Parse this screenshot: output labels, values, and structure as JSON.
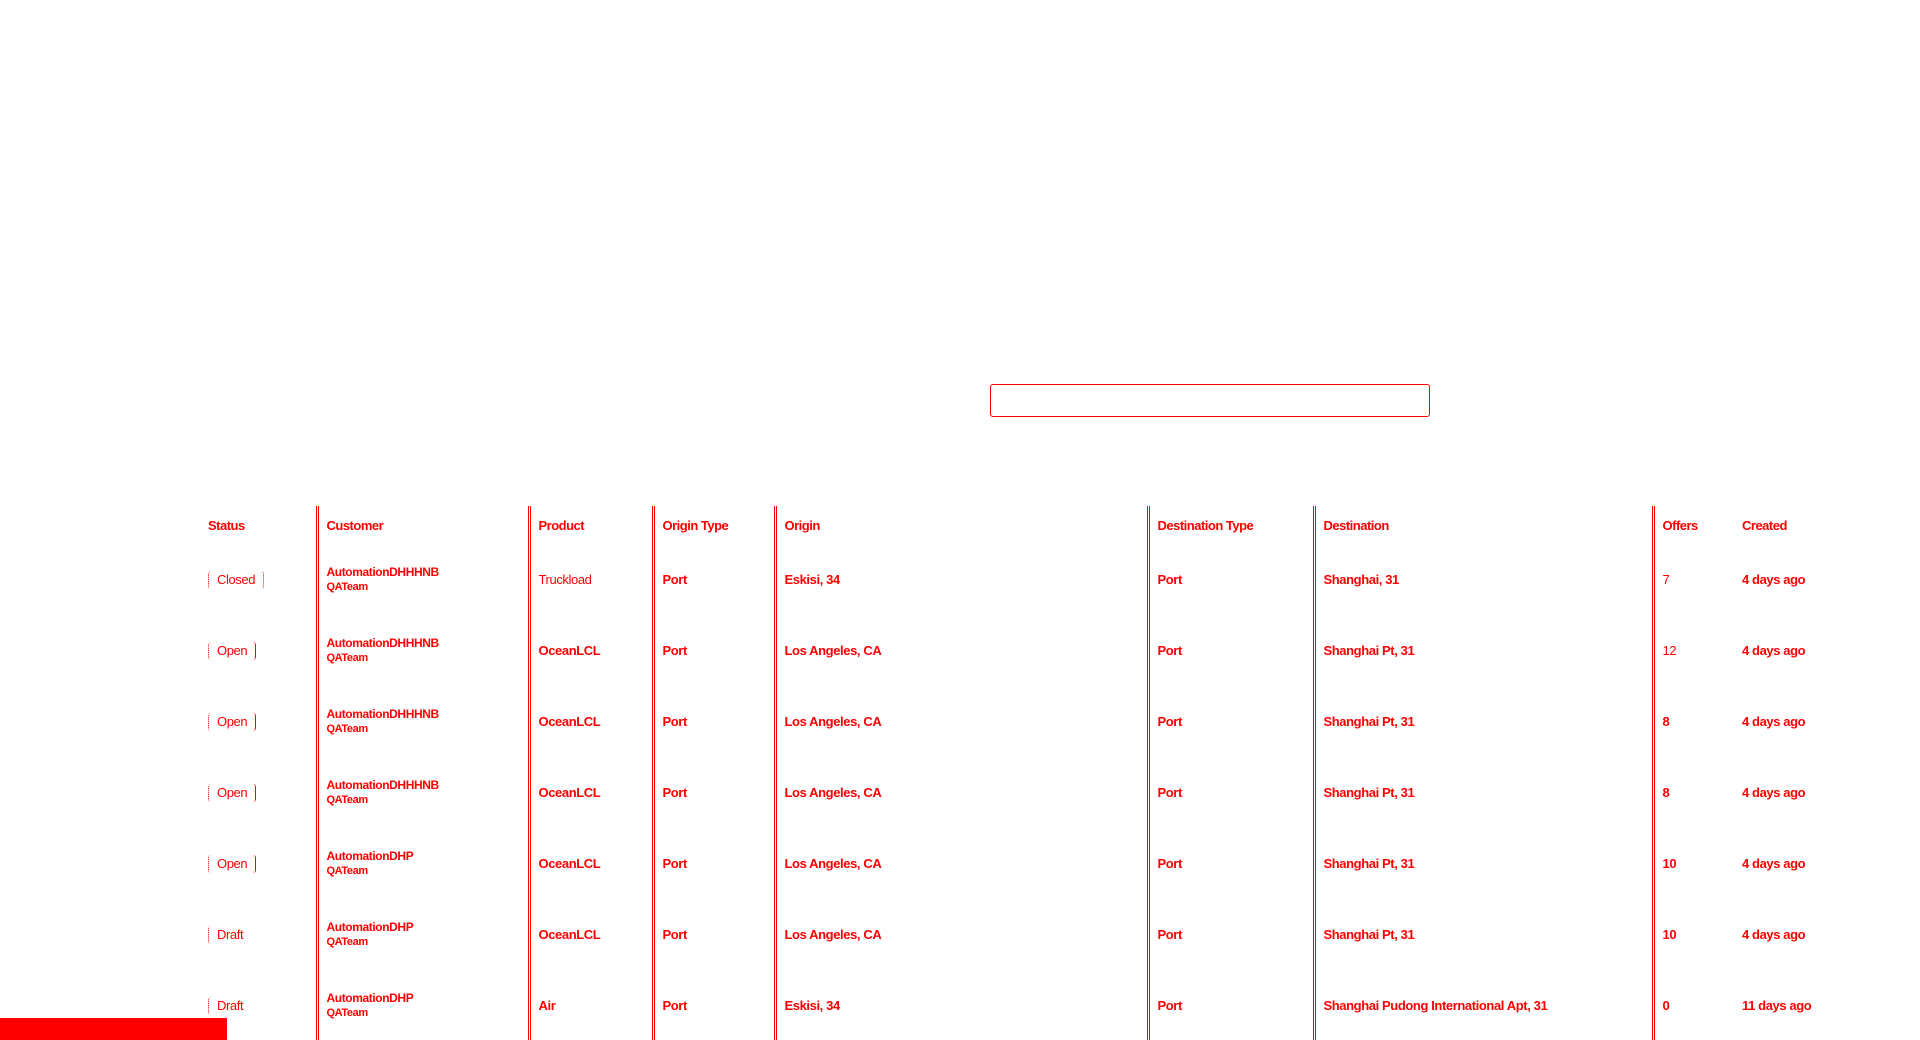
{
  "search": {
    "placeholder": "",
    "value": ""
  },
  "table": {
    "columns": [
      "Status",
      "Customer",
      "Product",
      "Origin Type",
      "Origin",
      "Destination Type",
      "Destination",
      "Offers",
      "Created"
    ],
    "rows": [
      {
        "status": "Closed",
        "customer": "AutomationDHHHNB",
        "customer_sub": "QATeam",
        "product": "Truckload",
        "origin_type": "Port",
        "origin": "Eskisi, 34",
        "destination_type": "Port",
        "destination": "Shanghai, 31",
        "offers": "7",
        "created": "4 days ago"
      },
      {
        "status": "Open",
        "customer": "AutomationDHHHNB",
        "customer_sub": "QATeam",
        "product": "OceanLCL",
        "origin_type": "Port",
        "origin": "Los Angeles, CA",
        "destination_type": "Port",
        "destination": "Shanghai Pt, 31",
        "offers": "12",
        "created": "4 days ago"
      },
      {
        "status": "Open",
        "customer": "AutomationDHHHNB",
        "customer_sub": "QATeam",
        "product": "OceanLCL",
        "origin_type": "Port",
        "origin": "Los Angeles, CA",
        "destination_type": "Port",
        "destination": "Shanghai Pt, 31",
        "offers": "8",
        "created": "4 days ago"
      },
      {
        "status": "Open",
        "customer": "AutomationDHHHNB",
        "customer_sub": "QATeam",
        "product": "OceanLCL",
        "origin_type": "Port",
        "origin": "Los Angeles, CA",
        "destination_type": "Port",
        "destination": "Shanghai Pt, 31",
        "offers": "8",
        "created": "4 days ago"
      },
      {
        "status": "Open",
        "customer": "AutomationDHP",
        "customer_sub": "QATeam",
        "product": "OceanLCL",
        "origin_type": "Port",
        "origin": "Los Angeles, CA",
        "destination_type": "Port",
        "destination": "Shanghai Pt, 31",
        "offers": "10",
        "created": "4 days ago"
      },
      {
        "status": "Draft",
        "customer": "AutomationDHP",
        "customer_sub": "QATeam",
        "product": "OceanLCL",
        "origin_type": "Port",
        "origin": "Los Angeles, CA",
        "destination_type": "Port",
        "destination": "Shanghai Pt, 31",
        "offers": "10",
        "created": "4 days ago"
      },
      {
        "status": "Draft",
        "customer": "AutomationDHP",
        "customer_sub": "QATeam",
        "product": "Air",
        "origin_type": "Port",
        "origin": "Eskisi, 34",
        "destination_type": "Port",
        "destination": "Shanghai Pudong International Apt, 31",
        "offers": "0",
        "created": "11 days ago"
      }
    ]
  },
  "colors": {
    "foreground": "#ff0000",
    "background": "#ffffff"
  }
}
